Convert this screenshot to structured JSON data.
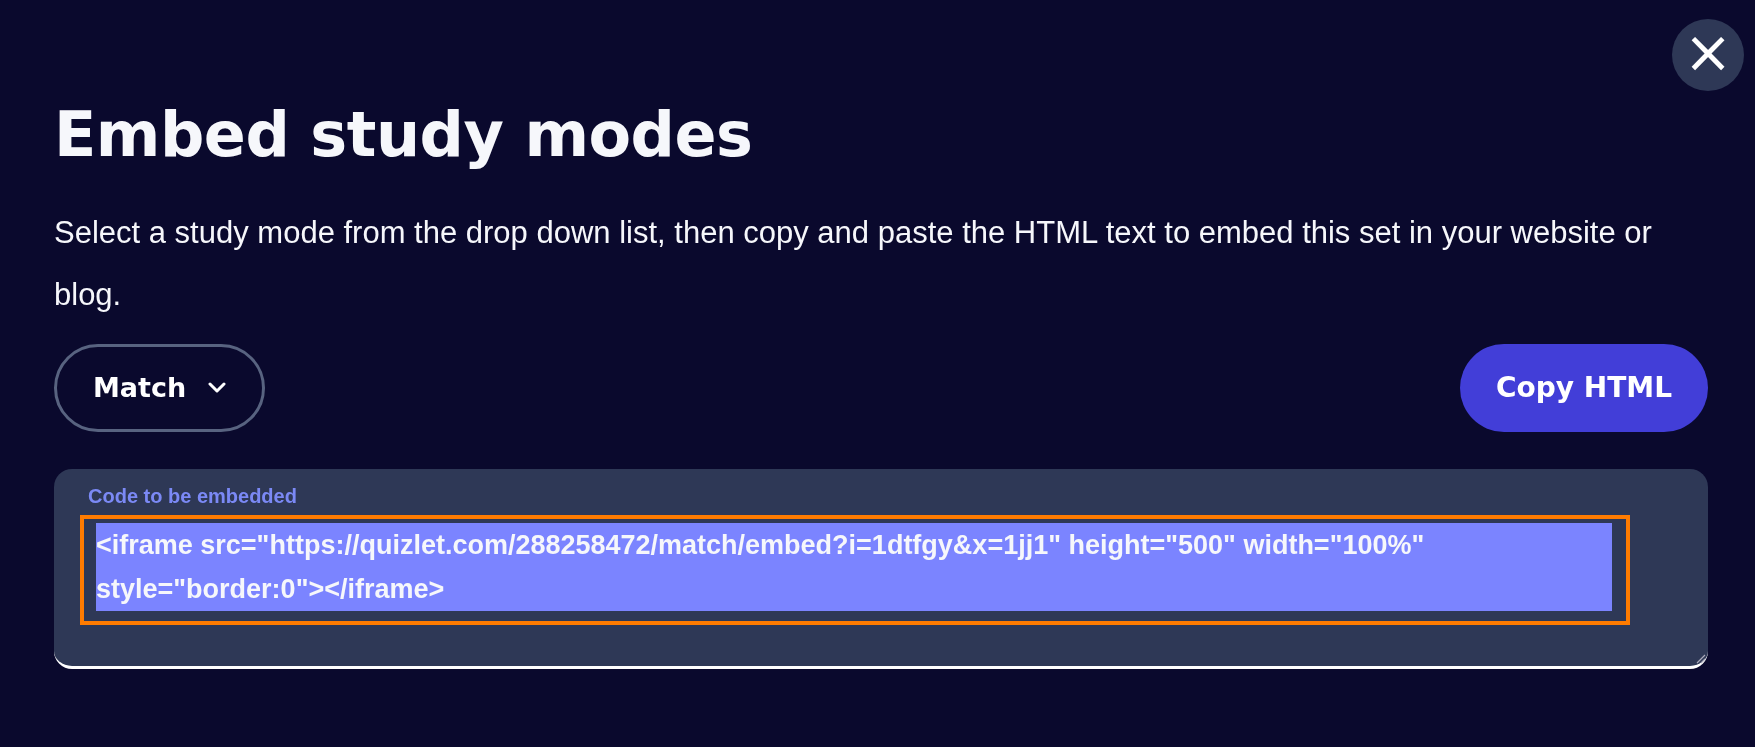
{
  "dialog": {
    "title": "Embed study modes",
    "description": "Select a study mode from the drop down list, then copy and paste the HTML text to embed this set in your website or blog.",
    "close_button": {
      "label": "×"
    },
    "mode_dropdown": {
      "value": "Match"
    },
    "copy_button": {
      "label": "Copy HTML"
    },
    "code_field": {
      "label": "Code to be embedded",
      "value": "<iframe src=\"https://quizlet.com/288258472/match/embed?i=1dtfgy&x=1jj1\" height=\"500\" width=\"100%\" style=\"border:0\"></iframe>",
      "selected": true,
      "highlighted": true
    }
  }
}
